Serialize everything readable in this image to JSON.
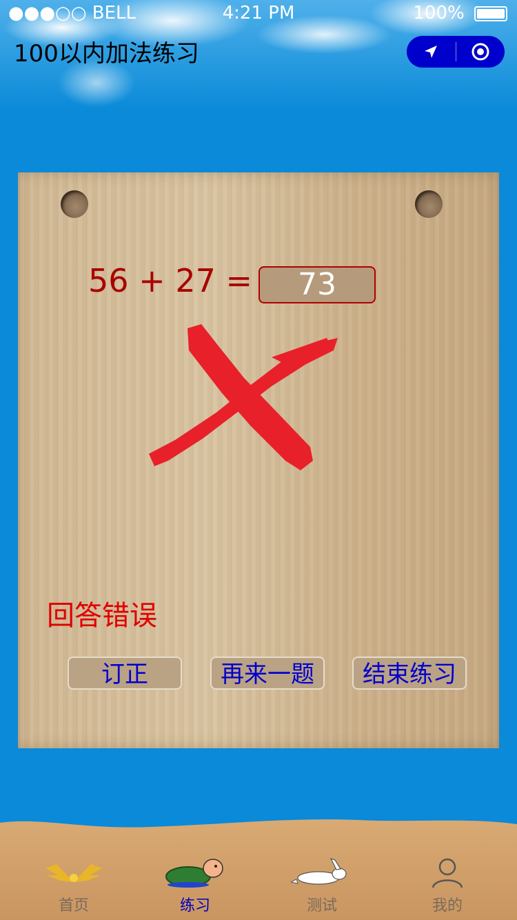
{
  "status_bar": {
    "carrier": "●●●○○ BELL",
    "time": "4:21 PM",
    "battery": "100%"
  },
  "header": {
    "title": "100以内加法练习",
    "capsule_left_icon": "location-arrow-icon",
    "capsule_right_icon": "target-icon"
  },
  "exercise": {
    "question": "56 + 27 =",
    "answer": "73",
    "result_icon": "wrong-cross-icon",
    "result_color": "#e8202a",
    "result_text": "回答错误"
  },
  "buttons": {
    "correct": "订正",
    "next": "再来一题",
    "end": "结束练习"
  },
  "tabbar": {
    "items": [
      {
        "label": "首页",
        "icon": "wings-icon",
        "active": false
      },
      {
        "label": "练习",
        "icon": "turtle-icon",
        "active": true
      },
      {
        "label": "测试",
        "icon": "rabbit-icon",
        "active": false
      },
      {
        "label": "我的",
        "icon": "user-icon",
        "active": false
      }
    ]
  }
}
